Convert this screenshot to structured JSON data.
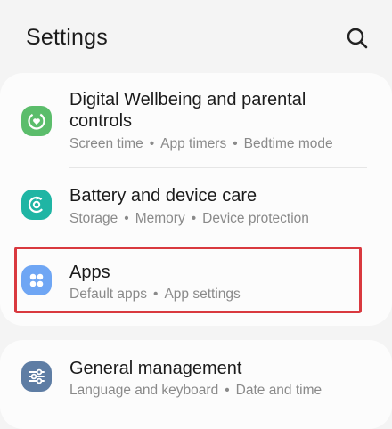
{
  "header": {
    "title": "Settings",
    "search_icon": "search-icon"
  },
  "items": [
    {
      "label_line1": "Digital Wellbeing and parental",
      "label_line2": "controls",
      "sub": [
        "Screen time",
        "App timers",
        "Bedtime mode"
      ],
      "icon": "wellbeing-heart-icon",
      "icon_color": "#5bbd6b"
    },
    {
      "label": "Battery and device care",
      "sub": [
        "Storage",
        "Memory",
        "Device protection"
      ],
      "icon": "device-care-icon",
      "icon_color": "#1fb5a4"
    },
    {
      "label": "Apps",
      "sub": [
        "Default apps",
        "App settings"
      ],
      "icon": "apps-grid-icon",
      "icon_color": "#6fa6f4"
    },
    {
      "label": "General management",
      "sub": [
        "Language and keyboard",
        "Date and time"
      ],
      "icon": "sliders-icon",
      "icon_color": "#5e7da4"
    }
  ],
  "separator": "•",
  "colors": {
    "highlight": "#d9393f",
    "background": "#f4f4f4",
    "card": "#fcfcfc"
  }
}
